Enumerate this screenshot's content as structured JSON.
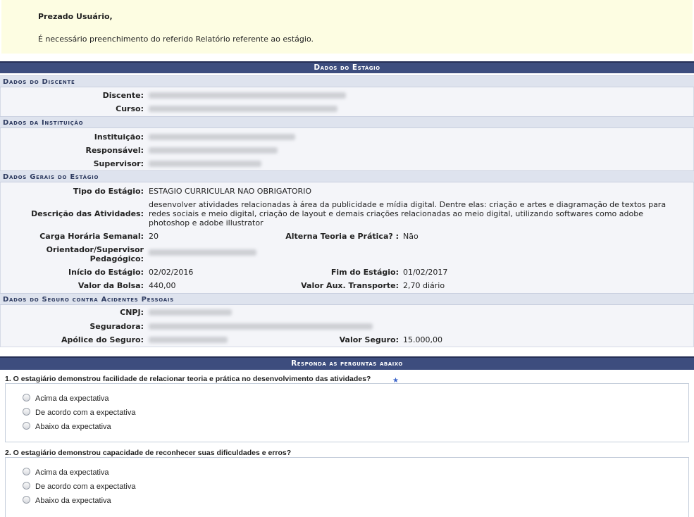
{
  "notice": {
    "greeting": "Prezado Usuário,",
    "message": "É necessário preenchimento do referido Relatório referente ao estágio."
  },
  "dados_estagio": {
    "caption": "Dados do Estágio",
    "discente_section": {
      "title": "Dados do Discente",
      "discente_label": "Discente:",
      "curso_label": "Curso:"
    },
    "instituicao_section": {
      "title": "Dados da Instituição",
      "instituicao_label": "Instituição:",
      "responsavel_label": "Responsável:",
      "supervisor_label": "Supervisor:"
    },
    "gerais_section": {
      "title": "Dados Gerais do Estágio",
      "tipo_label": "Tipo do Estágio:",
      "tipo_value": "ESTAGIO CURRICULAR NAO OBRIGATORIO",
      "descricao_label": "Descrição das Atividades:",
      "descricao_line1": "desenvolver atividades relacionadas à área da publicidade e mídia digital. Dentre elas: criação e artes e diagramação de textos para",
      "descricao_line2": "redes sociais e meio digital, criação de layout e demais criações relacionadas ao meio digital, utilizando softwares como adobe",
      "descricao_line3": "photoshop e adobe illustrator",
      "carga_label": "Carga Horária Semanal:",
      "carga_value": "20",
      "alterna_label": "Alterna Teoria e Prática? :",
      "alterna_value": "Não",
      "orientador_label_1": "Orientador/Supervisor",
      "orientador_label_2": "Pedagógico:",
      "inicio_label": "Início do Estágio:",
      "inicio_value": "02/02/2016",
      "fim_label": "Fim do Estágio:",
      "fim_value": "01/02/2017",
      "bolsa_label": "Valor da Bolsa:",
      "bolsa_value": "440,00",
      "transporte_label": "Valor Aux. Transporte:",
      "transporte_value": "2,70 diário"
    },
    "seguro_section": {
      "title": "Dados do Seguro contra Acidentes Pessoais",
      "cnpj_label": "CNPJ:",
      "seguradora_label": "Seguradora:",
      "apolice_label": "Apólice do Seguro:",
      "valor_seguro_label": "Valor Seguro:",
      "valor_seguro_value": "15.000,00"
    }
  },
  "perguntas": {
    "caption": "Responda as perguntas abaixo",
    "questions": [
      {
        "title": "1. O estagiário demonstrou facilidade de relacionar teoria e prática no desenvolvimento das atividades?",
        "options": [
          "Acima da expectativa",
          "De acordo com a expectativa",
          "Abaixo da expectativa"
        ]
      },
      {
        "title": "2. O estagiário demonstrou capacidade de reconhecer suas dificuldades e erros?",
        "options": [
          "Acima da expectativa",
          "De acordo com a expectativa",
          "Abaixo da expectativa"
        ]
      }
    ]
  },
  "icons": {
    "required": "required-star-icon",
    "radio": "radio-button"
  }
}
